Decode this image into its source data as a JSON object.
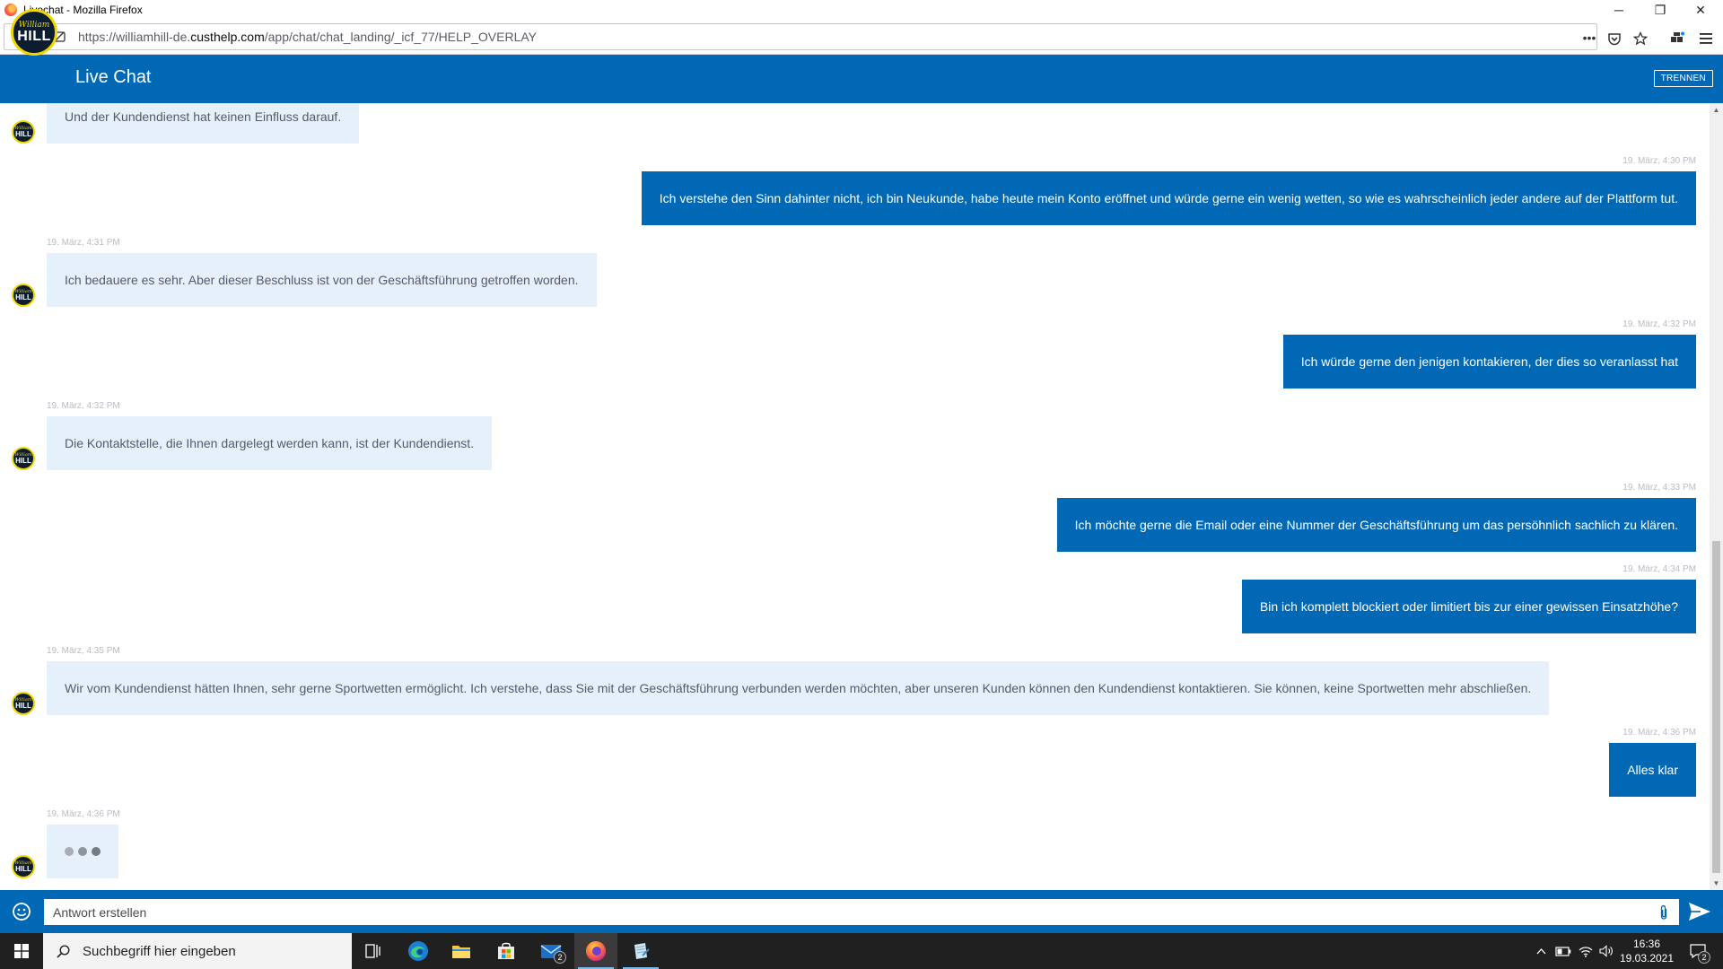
{
  "window": {
    "title": "Livechat - Mozilla Firefox",
    "minimize_label": "─",
    "restore_label": "❐",
    "close_label": "✕"
  },
  "browser": {
    "url_prefix": "https://williamhill-de.",
    "url_domain": "custhelp.com",
    "url_path": "/app/chat/chat_landing/_icf_77/HELP_OVERLAY",
    "page_actions_label": "•••"
  },
  "chat": {
    "logo_top": "William",
    "logo_bottom": "HILL",
    "title": "Live Chat",
    "disconnect_label": "TRENNEN",
    "messages": [
      {
        "from": "agent",
        "time": "",
        "text": "Und der Kundendienst hat keinen Einfluss darauf."
      },
      {
        "from": "user",
        "time": "19. März, 4:30 PM",
        "text": "Ich verstehe den Sinn dahinter nicht, ich bin Neukunde, habe heute mein Konto eröffnet und würde gerne ein wenig wetten, so wie es wahrscheinlich jeder andere auf der Plattform tut."
      },
      {
        "from": "agent",
        "time": "19. März, 4:31 PM",
        "text": "Ich bedauere es sehr. Aber dieser Beschluss ist von der Geschäftsführung getroffen worden."
      },
      {
        "from": "user",
        "time": "19. März, 4:32 PM",
        "text": "Ich würde gerne den jenigen kontakieren, der dies so veranlasst hat"
      },
      {
        "from": "agent",
        "time": "19. März, 4:32 PM",
        "text": "Die Kontaktstelle, die Ihnen dargelegt werden kann, ist der Kundendienst."
      },
      {
        "from": "user",
        "time": "19. März, 4:33 PM",
        "text": "Ich möchte gerne die Email oder eine Nummer der Geschäftsführung um das persöhnlich sachlich zu klären."
      },
      {
        "from": "user",
        "time": "19. März, 4:34 PM",
        "text": "Bin ich komplett blockiert oder limitiert bis zur einer gewissen Einsatzhöhe?"
      },
      {
        "from": "agent",
        "time": "19. März, 4:35 PM",
        "text": "Wir vom Kundendienst hätten Ihnen, sehr gerne Sportwetten ermöglicht. Ich verstehe, dass Sie mit der Geschäftsführung verbunden werden möchten, aber unseren Kunden können den Kundendienst kontaktieren. Sie können, keine Sportwetten mehr abschließen."
      },
      {
        "from": "user",
        "time": "19. März, 4:36 PM",
        "text": "Alles klar"
      },
      {
        "from": "agent",
        "time": "19. März, 4:36 PM",
        "text": "",
        "typing": true
      }
    ],
    "composer": {
      "placeholder": "Antwort erstellen"
    }
  },
  "taskbar": {
    "search_placeholder": "Suchbegriff hier eingeben",
    "mail_badge": "2",
    "notification_badge": "2",
    "clock_time": "16:36",
    "clock_date": "19.03.2021"
  },
  "colors": {
    "brand_blue": "#0068b4",
    "agent_bubble": "#e6f0fb",
    "logo_yellow": "#f2d600",
    "logo_navy": "#0b1d2e"
  }
}
